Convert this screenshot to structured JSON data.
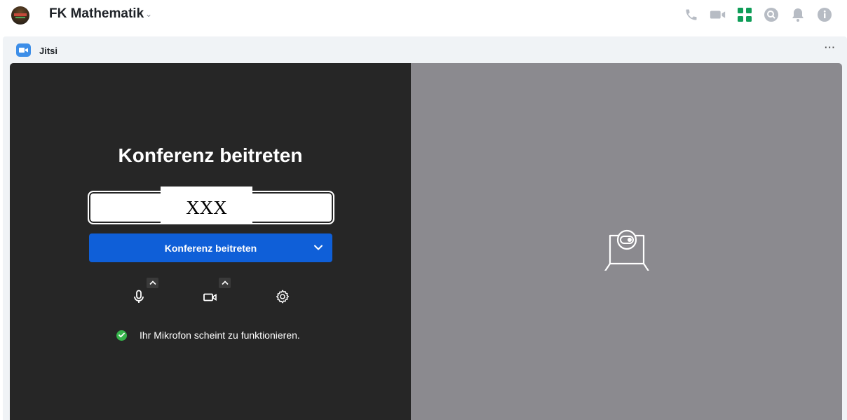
{
  "topbar": {
    "team_name": "FK Mathematik",
    "team_chevron": "⌄",
    "icons": [
      "phone-icon",
      "video-icon",
      "apps-grid-icon",
      "search-icon",
      "bell-icon",
      "info-icon"
    ],
    "accent_color": "#0f9d58"
  },
  "panel": {
    "app_title": "Jitsi",
    "more_label": "···"
  },
  "prejoin": {
    "title": "Konferenz beitreten",
    "room_value": "XXX",
    "join_button_label": "Konferenz beitreten",
    "status_text": "Ihr Mikrofon scheint zu funktionieren.",
    "controls": [
      "microphone-icon",
      "camera-icon",
      "settings-icon"
    ],
    "button_color": "#0f5fd8",
    "status_color": "#35b34a"
  }
}
